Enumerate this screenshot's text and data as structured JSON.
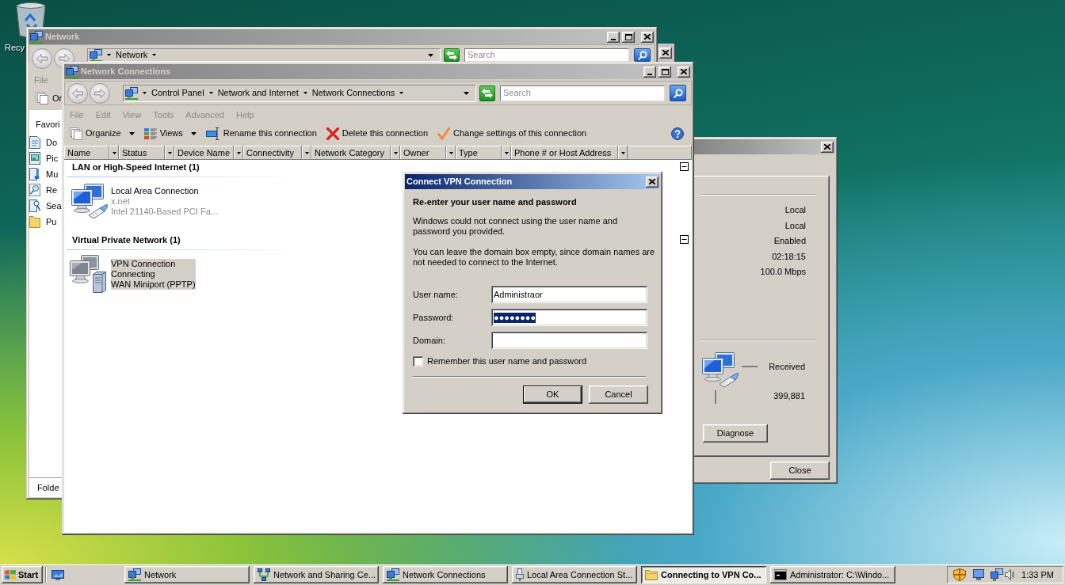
{
  "desktop_icons": [
    {
      "label": "Recy"
    }
  ],
  "network_window": {
    "title": "Network",
    "active": false,
    "breadcrumbs": [
      "Network"
    ],
    "search_placeholder": "Search",
    "menu": [
      {
        "label": "File",
        "disabled": true
      }
    ],
    "toolbar": [
      {
        "label": "Or"
      }
    ],
    "nav_heading": "Favori",
    "nav_items": [
      "Do",
      "Pic",
      "Mu",
      "Re",
      "Sea",
      "Pu"
    ],
    "folders_label": "Folde"
  },
  "status_window": {
    "active": false,
    "values": [
      "Local",
      "Local",
      "Enabled",
      "02:18:15",
      "100.0 Mbps"
    ],
    "activity": {
      "label": "Received",
      "value": "399,881"
    },
    "buttons": [
      "Diagnose"
    ],
    "close_button": "Close"
  },
  "network_connections_window": {
    "title": "Network Connections",
    "active": false,
    "breadcrumbs": [
      "Control Panel",
      "Network and Internet",
      "Network Connections"
    ],
    "search_placeholder": "Search",
    "menu": [
      {
        "label": "File",
        "disabled": true
      },
      {
        "label": "Edit",
        "disabled": true
      },
      {
        "label": "View",
        "disabled": true
      },
      {
        "label": "Tools",
        "disabled": true
      },
      {
        "label": "Advanced",
        "disabled": true
      },
      {
        "label": "Help",
        "disabled": true
      }
    ],
    "toolbar": [
      {
        "label": "Organize",
        "dropdown": true
      },
      {
        "label": "Views",
        "dropdown": true
      },
      {
        "label": "Rename this connection",
        "dropdown": false
      },
      {
        "label": "Delete this connection",
        "dropdown": false
      },
      {
        "label": "Change settings of this connection",
        "dropdown": false
      }
    ],
    "columns": [
      "Name",
      "Status",
      "Device Name",
      "Connectivity",
      "Network Category",
      "Owner",
      "Type",
      "Phone # or Host Address"
    ],
    "groups": [
      {
        "title": "LAN or High-Speed Internet (1)",
        "expanded": true,
        "items": [
          {
            "kind": "lan",
            "name": "Local Area Connection",
            "status": "x.net",
            "device": "Intel 21140-Based PCI Fa...",
            "selected": false
          }
        ]
      },
      {
        "title": "Virtual Private Network (1)",
        "expanded": true,
        "items": [
          {
            "kind": "vpn",
            "name": "VPN Connection",
            "status": "Connecting",
            "device": "WAN Miniport (PPTP)",
            "selected": true
          }
        ]
      }
    ]
  },
  "dialog": {
    "title": "Connect VPN Connection",
    "active": true,
    "heading": "Re-enter your user name and password",
    "paragraphs": [
      "Windows could not connect using the user name and\npassword you provided.",
      "You can leave the domain box empty, since domain names are\nnot needed to connect to the Internet."
    ],
    "fields": [
      {
        "label": "User name:",
        "value": "Administraor",
        "value_selected": false
      },
      {
        "label": "Password:",
        "value": "●●●●●●●●",
        "value_selected": true
      },
      {
        "label": "Domain:"
      }
    ],
    "checkbox": {
      "label": "Remember this user name and password",
      "checked": false
    },
    "buttons": [
      {
        "label": "OK",
        "default": true
      },
      {
        "label": "Cancel",
        "default": false
      }
    ]
  },
  "taskbar": {
    "start": "Start",
    "items": [
      {
        "label": "Network",
        "selected": false
      },
      {
        "label": "Network and Sharing Ce...",
        "selected": false
      },
      {
        "label": "Network Connections",
        "selected": false
      },
      {
        "label": "Local Area Connection St...",
        "selected": false
      },
      {
        "label": "Connecting to VPN Co...",
        "selected": true
      },
      {
        "label": "Administrator: C:\\Windo...",
        "selected": false
      }
    ],
    "clock": "1:33 PM"
  }
}
